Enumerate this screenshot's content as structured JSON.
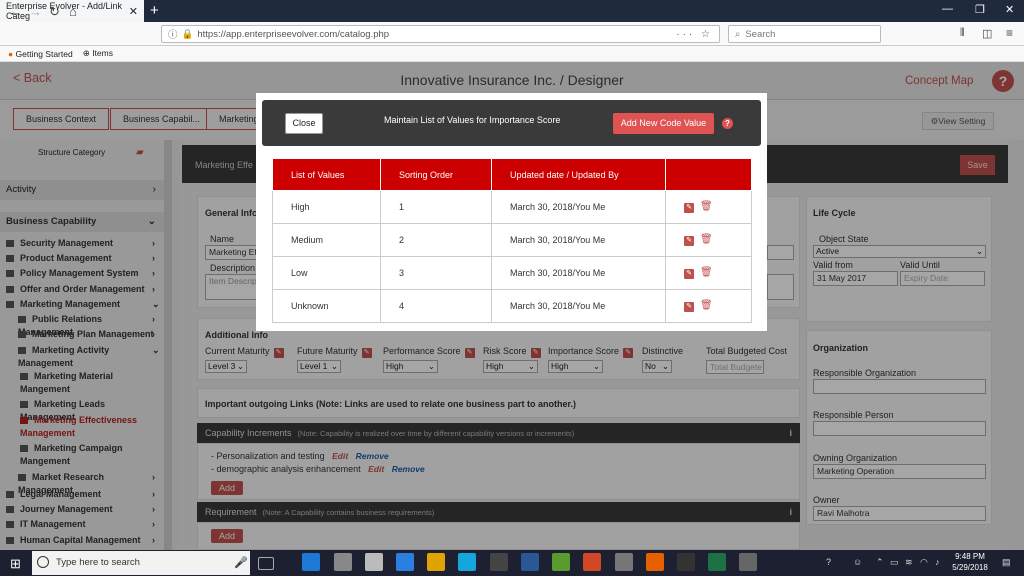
{
  "browser": {
    "tab_title": "Enterprise Evolver - Add/Link Categ",
    "url": "https://app.enterpriseevolver.com/catalog.php",
    "search_placeholder": "Search",
    "bookmarks": [
      "Getting Started",
      "Items"
    ]
  },
  "app": {
    "back_label": "< Back",
    "title": "Innovative Insurance Inc. / Designer",
    "concept_map": "Concept Map",
    "help": "?",
    "view_setting": "⚙View Setting",
    "breadcrumbs": [
      "Business Context",
      "Business Capabil...",
      "Marketing"
    ],
    "accent_color": "#c0504d"
  },
  "sidebar": {
    "structure_category": "Structure Category",
    "activity": "Activity",
    "business_capability": "Business Capability",
    "items": [
      {
        "label": "Security Management",
        "indent": 0
      },
      {
        "label": "Product Management",
        "indent": 0
      },
      {
        "label": "Policy Management System",
        "indent": 0
      },
      {
        "label": "Offer and Order Management",
        "indent": 0
      },
      {
        "label": "Marketing Management",
        "indent": 0
      },
      {
        "label": "Public Relations Management",
        "indent": 1
      },
      {
        "label": "Marketing Plan Management",
        "indent": 1
      },
      {
        "label": "Marketing Activity Management",
        "indent": 1
      },
      {
        "label": "Marketing Material Mangement",
        "indent": 2
      },
      {
        "label": "Marketing Leads Management",
        "indent": 2
      },
      {
        "label": "Marketing Effectiveness Management",
        "indent": 2
      },
      {
        "label": "Marketing Campaign Mangement",
        "indent": 2
      },
      {
        "label": "Market Research Management",
        "indent": 1
      },
      {
        "label": "Legal Management",
        "indent": 0
      },
      {
        "label": "Journey Management",
        "indent": 0
      },
      {
        "label": "IT Management",
        "indent": 0
      },
      {
        "label": "Human Capital Management",
        "indent": 0
      }
    ]
  },
  "main": {
    "title_prefix": "Marketing Effe",
    "save": "Save",
    "general_info": "General Info",
    "name_label": "Name",
    "name_value": "Marketing Ef",
    "description_label": "Description",
    "description_placeholder": "Item Descrip",
    "additional_info": "Additional Info",
    "attributes": [
      {
        "label": "Current Maturity",
        "value": "Level 3"
      },
      {
        "label": "Future Maturity",
        "value": "Level 1"
      },
      {
        "label": "Performance Score",
        "value": "High"
      },
      {
        "label": "Risk Score",
        "value": "High"
      },
      {
        "label": "Importance Score",
        "value": "High"
      },
      {
        "label": "Distinctive",
        "value": "No"
      },
      {
        "label": "Total Budgeted Cost",
        "value": "Total Budgete"
      }
    ],
    "links_heading": "Important outgoing Links (Note: Links are used to relate one business part to another.)",
    "capability_increments": "Capability Increments",
    "capability_note": "(Note: Capability is realized over time by different capability versions or increments)",
    "increments": [
      {
        "text": "- Personalization and testing",
        "edit": "Edit",
        "remove": "Remove"
      },
      {
        "text": "- demographic analysis enhancement",
        "edit": "Edit",
        "remove": "Remove"
      }
    ],
    "add": "Add",
    "requirement": "Requirement",
    "requirement_note": "(Note: A Capability contains business requirements)"
  },
  "right": {
    "life_cycle": "Life Cycle",
    "object_state": "Object State",
    "state_value": "Active",
    "valid_from": "Valid from",
    "valid_from_value": "31 May 2017",
    "valid_until": "Valid Until",
    "expiry_placeholder": "Expiry Date",
    "organization": "Organization",
    "responsible_org": "Responsible Organization",
    "responsible_person": "Responsible Person",
    "owning_org": "Owning Organization",
    "owning_org_value": "Marketing Operation",
    "owner": "Owner",
    "owner_value": "Ravi Malhotra"
  },
  "modal": {
    "close": "Close",
    "title": "Maintain List of Values for Importance Score",
    "add_new": "Add New Code Value",
    "help": "?",
    "columns": [
      "List of Values",
      "Sorting Order",
      "Updated date / Updated By",
      ""
    ],
    "rows": [
      {
        "value": "High",
        "order": "1",
        "updated": "March 30, 2018/You Me"
      },
      {
        "value": "Medium",
        "order": "2",
        "updated": "March 30, 2018/You Me"
      },
      {
        "value": "Low",
        "order": "3",
        "updated": "March 30, 2018/You Me"
      },
      {
        "value": "Unknown",
        "order": "4",
        "updated": "March 30, 2018/You Me"
      }
    ]
  },
  "taskbar": {
    "search_placeholder": "Type here to search",
    "time": "9:48 PM",
    "date": "5/29/2018"
  }
}
